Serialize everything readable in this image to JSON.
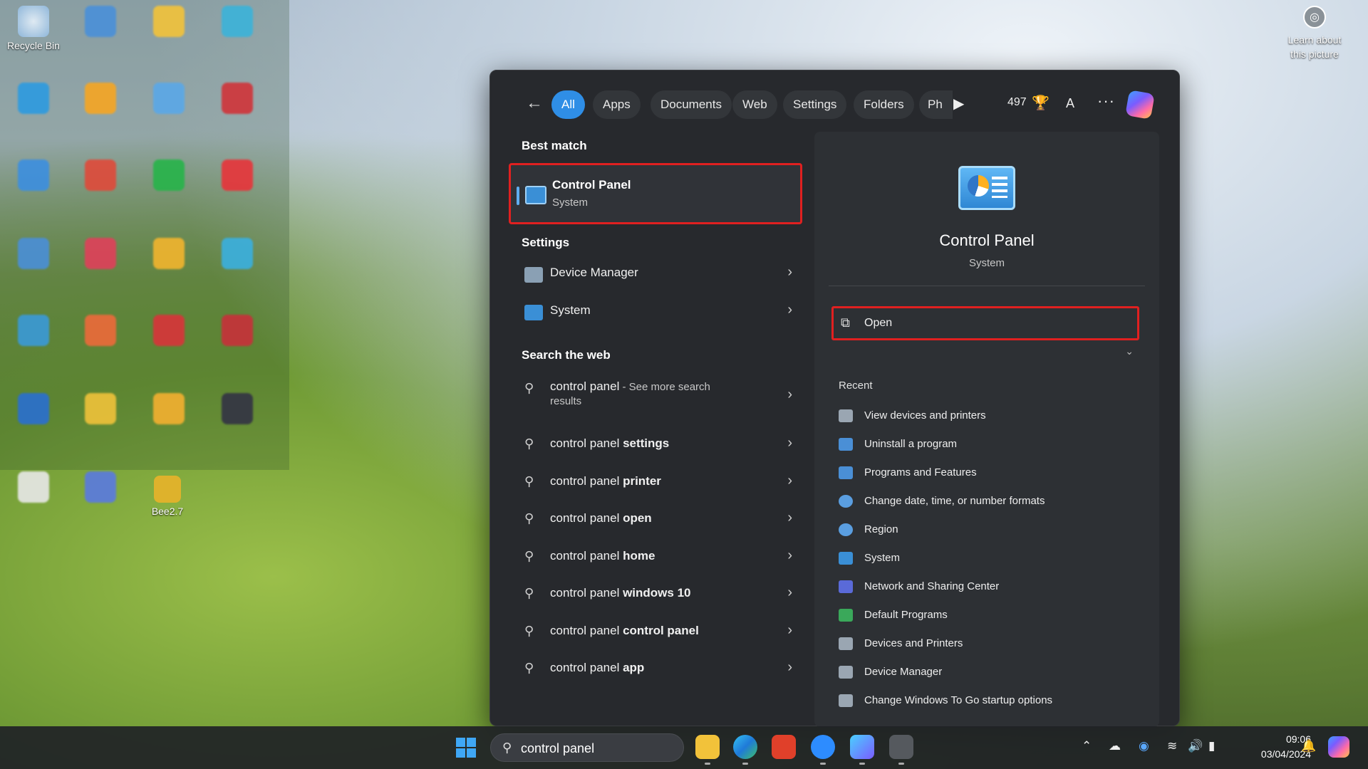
{
  "desktop": {
    "recycle_bin": "Recycle Bin",
    "bee_label": "Bee2.7",
    "learn_picture": "Learn about this picture"
  },
  "search_panel": {
    "tabs": [
      "All",
      "Apps",
      "Documents",
      "Web",
      "Settings",
      "Folders",
      "Ph"
    ],
    "points": "497",
    "avatar_initial": "A",
    "best_match_heading": "Best match",
    "best_match": {
      "title": "Control Panel",
      "subtitle": "System"
    },
    "settings_heading": "Settings",
    "settings_items": [
      "Device Manager",
      "System"
    ],
    "web_heading": "Search the web",
    "web_results": [
      {
        "prefix": "control panel",
        "bold": "",
        "suffix": " - See more search",
        "line2": "results"
      },
      {
        "prefix": "control panel ",
        "bold": "settings"
      },
      {
        "prefix": "control panel ",
        "bold": "printer"
      },
      {
        "prefix": "control panel ",
        "bold": "open"
      },
      {
        "prefix": "control panel ",
        "bold": "home"
      },
      {
        "prefix": "control panel ",
        "bold": "windows 10"
      },
      {
        "prefix": "control panel ",
        "bold": "control panel"
      },
      {
        "prefix": "control panel ",
        "bold": "app"
      }
    ],
    "preview": {
      "title": "Control Panel",
      "subtitle": "System",
      "open_label": "Open",
      "recent_heading": "Recent",
      "recent_items": [
        "View devices and printers",
        "Uninstall a program",
        "Programs and Features",
        "Change date, time, or number formats",
        "Region",
        "System",
        "Network and Sharing Center",
        "Default Programs",
        "Devices and Printers",
        "Device Manager",
        "Change Windows To Go startup options"
      ]
    }
  },
  "taskbar": {
    "search_value": "control panel",
    "time": "09:06",
    "date": "03/04/2024"
  },
  "colors": {
    "accent": "#2f8ee6",
    "highlight_box": "#e02020",
    "panel_bg": "#27292d"
  }
}
